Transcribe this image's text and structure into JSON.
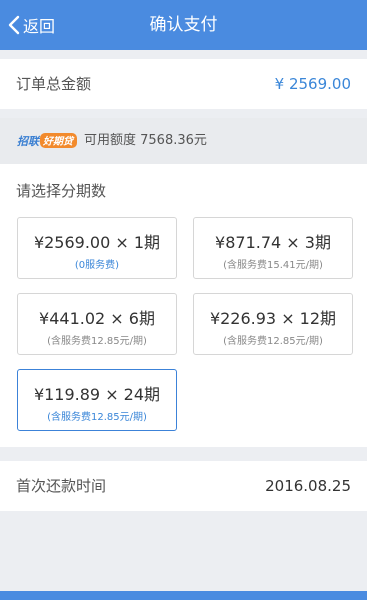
{
  "nav": {
    "back_label": "返回",
    "title": "确认支付"
  },
  "order": {
    "label": "订单总金额",
    "amount": "¥ 2569.00"
  },
  "credit": {
    "logo_text": "招联好期贷",
    "available_text": "可用额度 7568.36元"
  },
  "installments": {
    "title": "请选择分期数",
    "options": [
      {
        "main": "¥2569.00 × 1期",
        "sub": "(0服务费)"
      },
      {
        "main": "¥871.74 × 3期",
        "sub": "(含服务费15.41元/期)"
      },
      {
        "main": "¥441.02 × 6期",
        "sub": "(含服务费12.85元/期)"
      },
      {
        "main": "¥226.93 × 12期",
        "sub": "(含服务费12.85元/期)"
      },
      {
        "main": "¥119.89 × 24期",
        "sub": "(含服务费12.85元/期)"
      }
    ],
    "selected": "¥119.89 × 24期"
  },
  "first_repayment": {
    "label": "首次还款时间",
    "date": "2016.08.25"
  },
  "colors": {
    "brand": "#4a8be0",
    "accent": "#3a86d8",
    "background": "#eceef2"
  }
}
